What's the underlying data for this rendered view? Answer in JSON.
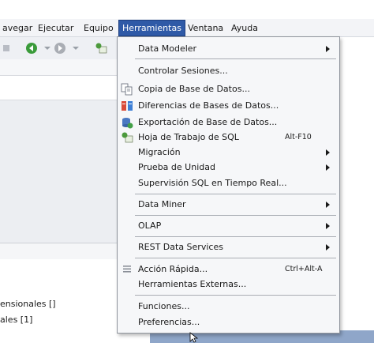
{
  "menubar": {
    "items": [
      {
        "label": "avegar",
        "ul": ""
      },
      {
        "label": "Ejecutar",
        "ul": "E"
      },
      {
        "label": "Equipo",
        "ul": "p"
      },
      {
        "label": "Herramientas",
        "ul": "H"
      },
      {
        "label": "Ventana",
        "ul": "V"
      },
      {
        "label": "Ayuda",
        "ul": "y"
      }
    ]
  },
  "left_panel": {
    "lines": [
      "ensionales []",
      "ales [1]"
    ]
  },
  "dropdown": {
    "items": [
      {
        "label": "Data Modeler",
        "submenu": true
      },
      {
        "label": "Controlar Sesiones...",
        "icon": "none"
      },
      {
        "label": "Copia de Base de Datos...",
        "icon": "copy-db-icon"
      },
      {
        "label": "Diferencias de Bases de Datos...",
        "icon": "diff-db-icon"
      },
      {
        "label": "Exportación de Base de Datos...",
        "icon": "export-db-icon"
      },
      {
        "label": "Hoja de Trabajo de SQL",
        "shortcut": "Alt-F10",
        "icon": "sql-worksheet-icon"
      },
      {
        "label": "Migración",
        "submenu": true
      },
      {
        "label": "Prueba de Unidad",
        "submenu": true
      },
      {
        "label": "Supervisión SQL en Tiempo Real..."
      },
      {
        "label": "Data Miner",
        "submenu": true
      },
      {
        "label": "OLAP",
        "submenu": true
      },
      {
        "label": "REST Data Services",
        "submenu": true
      },
      {
        "label": "Acción Rápida...",
        "shortcut": "Ctrl+Alt-A",
        "icon": "quick-action-icon"
      },
      {
        "label": "Herramientas Externas..."
      },
      {
        "label": "Funciones..."
      },
      {
        "label": "Preferencias..."
      }
    ]
  },
  "colors": {
    "menubar_active": "#2f5aa7",
    "menu_bg": "#f6f7f9",
    "desktop_blue": "#8fa6c9"
  }
}
